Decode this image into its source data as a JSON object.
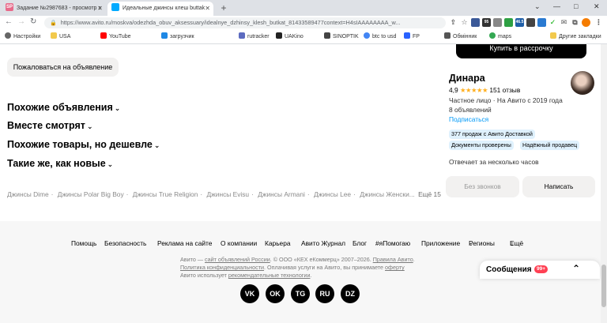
{
  "browser": {
    "tabs": [
      "Задание №2987683 - просмотр з",
      "Идеальные джинсы клеш buttak"
    ],
    "url": "https://www.avito.ru/moskva/odezhda_obuv_aksessuary/idealnye_dzhinsy_klesh_butkat_81433589477context=H4sIAAAAAAAA_w...",
    "ext_labels": [
      "95",
      "LTC",
      "46.5"
    ]
  },
  "bookmarks": [
    "Настройки",
    "USA",
    "YouTube",
    "загрузчик",
    "rutracker",
    "UAKino",
    "SINOPTIK",
    "btc to usd",
    "FP",
    "Обмінник",
    "maps",
    "Другие закладки"
  ],
  "main": {
    "report_button": "Пожаловаться на объявление",
    "sections": [
      "Похожие объявления",
      "Вместе смотрят",
      "Похожие товары, но дешевле",
      "Такие же, как новые"
    ],
    "links": [
      "Джинсы Dime",
      "Джинсы Polar Big Boy",
      "Джинсы True Religion",
      "Джинсы Evisu",
      "Джинсы Armani",
      "Джинсы Lee",
      "Джинсы Женски..."
    ],
    "links_more": "Ещё 15"
  },
  "seller": {
    "buy_button": "Купить в рассрочку",
    "name": "Динара",
    "rating": "4,9",
    "reviews": "151 отзыв",
    "since": "Частное лицо · На Авито с 2019 года",
    "count": "8 объявлений",
    "subscribe": "Подписаться",
    "badges": [
      "377 продаж с Авито Доставкой",
      "Документы проверены",
      "Надёжный продавец"
    ],
    "response": "Отвечает за несколько часов",
    "no_calls": "Без звонков",
    "write": "Написать"
  },
  "footer": {
    "nav": [
      "Помощь",
      "Безопасность",
      "Реклама на сайте",
      "О компании",
      "Карьера",
      "Авито Журнал",
      "Блог",
      "#яПомогаю",
      "Приложение",
      "Регионы",
      "Ещё"
    ],
    "legal1_prefix": "Авито —",
    "legal1_link1": "сайт объявлений России",
    "legal1_mid": ". © ООО «КЕХ еКоммерц» 2007–2026.",
    "legal1_link2": "Правила Авито",
    "legal2_link1": "Политика конфиденциальности",
    "legal2_mid": ". Оплачивая услуги на Авито, вы принимаете",
    "legal2_link2": "оферту",
    "legal3_prefix": "Авито использует",
    "legal3_link": "рекомендательные технологии",
    "social": [
      "VK",
      "OK",
      "TG",
      "RU",
      "DZ"
    ]
  },
  "messages": {
    "label": "Сообщения",
    "badge": "99+"
  },
  "colors": {
    "accent": "#0099f7",
    "badge_bg": "#dff1fd",
    "notify": "#ff4053"
  }
}
